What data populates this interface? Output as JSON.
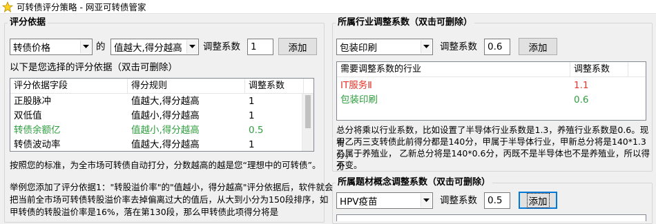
{
  "window": {
    "title": "可转债评分策略 - 网亚可转债管家"
  },
  "colors": {
    "red": "#e8332a",
    "green": "#2e9e3e",
    "black": "#000000"
  },
  "icons": {
    "app": "star-icon",
    "dropdown": "chevron-down-icon"
  },
  "left": {
    "group_title": "评分依据",
    "field_select": "转债价格",
    "de_label": "的",
    "rule_select": "值越大,得分越高",
    "coef_label": "调整系数",
    "coef_value": "1",
    "add_button": "添加",
    "selected_label": "以下是您选择的评分依据（双击可删除）",
    "table": {
      "headers": [
        "评分依据字段",
        "得分规则",
        "调整系数"
      ],
      "rows": [
        {
          "field": "正股脉冲",
          "rule": "值越大,得分越高",
          "coef": "1",
          "color": "#000000"
        },
        {
          "field": "双低值",
          "rule": "值越小,得分越高",
          "coef": "1",
          "color": "#000000"
        },
        {
          "field": "转债余额亿",
          "rule": "值越小,得分越高",
          "coef": "0.5",
          "color": "#2e9e3e"
        },
        {
          "field": "转债波动率",
          "rule": "值越大,得分越高",
          "coef": "1",
          "color": "#000000"
        }
      ]
    },
    "note1": "按照您的标准，为全市场可转债自动打分，分数越高的越是您“理想中的可转债”。",
    "note2_line1": "举例您添加了评分依据1：\"转股溢价率\"的\"值越小，得分越高\"评分依据后，软件就会",
    "note2_line2": "把当前全市场可转债转股溢价率去掉偏离过大的值后，从大到小分为150段排序，如",
    "note2_line3": "甲转债的转股溢价率是16%，落在第130段，那么甲转债此项得分将是"
  },
  "industry": {
    "group_title": "所属行业调整系数（双击可删除）",
    "select": "包装印刷",
    "coef_label": "调整系数",
    "coef_value": "0.6",
    "add_button": "添加",
    "table": {
      "headers": [
        "需要调整系数的行业",
        "调整系数"
      ],
      "rows": [
        {
          "name": "IT服务Ⅱ",
          "coef": "1.1",
          "color": "#e8332a"
        },
        {
          "name": "包装印刷",
          "coef": "0.6",
          "color": "#2e9e3e"
        }
      ]
    },
    "note_line1": "总分将乘以行业系数，比如设置了半导体行业系数是1.3，养殖行业系数是0.6。现有",
    "note_line2": "甲乙丙三支转债此前得分都是140分，甲属于半导体行业，甲新总分将是140*1.3分，",
    "note_line3": "乙属于养殖业，  乙新总分将是140*0.6分，丙既不是半导体也不是养殖业，所以得分",
    "note_line4": "不变。"
  },
  "concept": {
    "group_title": "所属题材概念调整系数（双击可删除）",
    "select": "HPV疫苗",
    "coef_label": "调整系数",
    "coef_value": "0.5",
    "add_button": "添加"
  }
}
